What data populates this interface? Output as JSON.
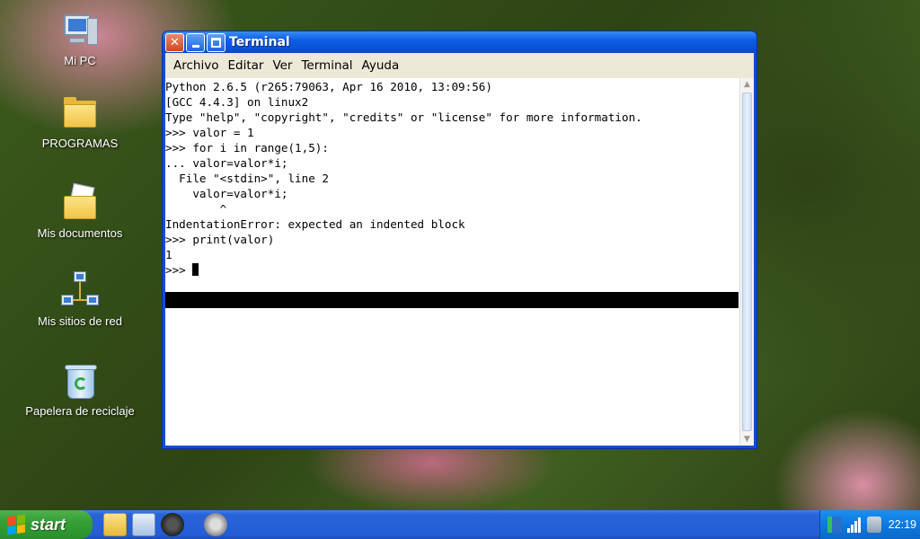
{
  "desktop": {
    "icons": [
      {
        "label": "Mi PC",
        "icon": "computer-icon"
      },
      {
        "label": "PROGRAMAS",
        "icon": "folder-icon"
      },
      {
        "label": "Mis documentos",
        "icon": "documents-folder-icon"
      },
      {
        "label": "Mis sitios de red",
        "icon": "network-icon"
      },
      {
        "label": "Papelera de reciclaje",
        "icon": "recycle-bin-icon"
      }
    ]
  },
  "window": {
    "title": "Terminal",
    "menu": [
      "Archivo",
      "Editar",
      "Ver",
      "Terminal",
      "Ayuda"
    ],
    "terminal_lines": [
      "Python 2.6.5 (r265:79063, Apr 16 2010, 13:09:56)",
      "[GCC 4.4.3] on linux2",
      "Type \"help\", \"copyright\", \"credits\" or \"license\" for more information.",
      ">>> valor = 1",
      ">>> for i in range(1,5):",
      "... valor=valor*i;",
      "  File \"<stdin>\", line 2",
      "    valor=valor*i;",
      "        ^",
      "IndentationError: expected an indented block",
      ">>> print(valor)",
      "1"
    ],
    "prompt": ">>> "
  },
  "taskbar": {
    "start_label": "start",
    "quick_launch": [
      "folder-icon",
      "text-editor-icon",
      "media-player-icon",
      "webcam-icon"
    ],
    "tray_icons": [
      "network-status-icon",
      "signal-strength-icon",
      "battery-icon"
    ],
    "clock": "22:19"
  },
  "colors": {
    "titlebar": "#0a4fd4",
    "taskbar": "#245dd6",
    "start_button": "#35a035",
    "tray": "#0e79e0"
  }
}
